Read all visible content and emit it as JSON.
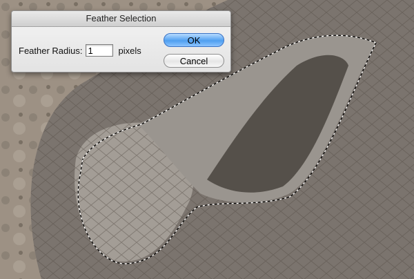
{
  "dialog": {
    "title": "Feather Selection",
    "field_label": "Feather Radius:",
    "field_value": "1",
    "unit": "pixels",
    "ok_label": "OK",
    "cancel_label": "Cancel"
  },
  "colors": {
    "ok_button": "#5aa7f3",
    "dialog_bg": "#ececec",
    "rock_bg": "#9a8f82",
    "skin": "#7b746e"
  }
}
